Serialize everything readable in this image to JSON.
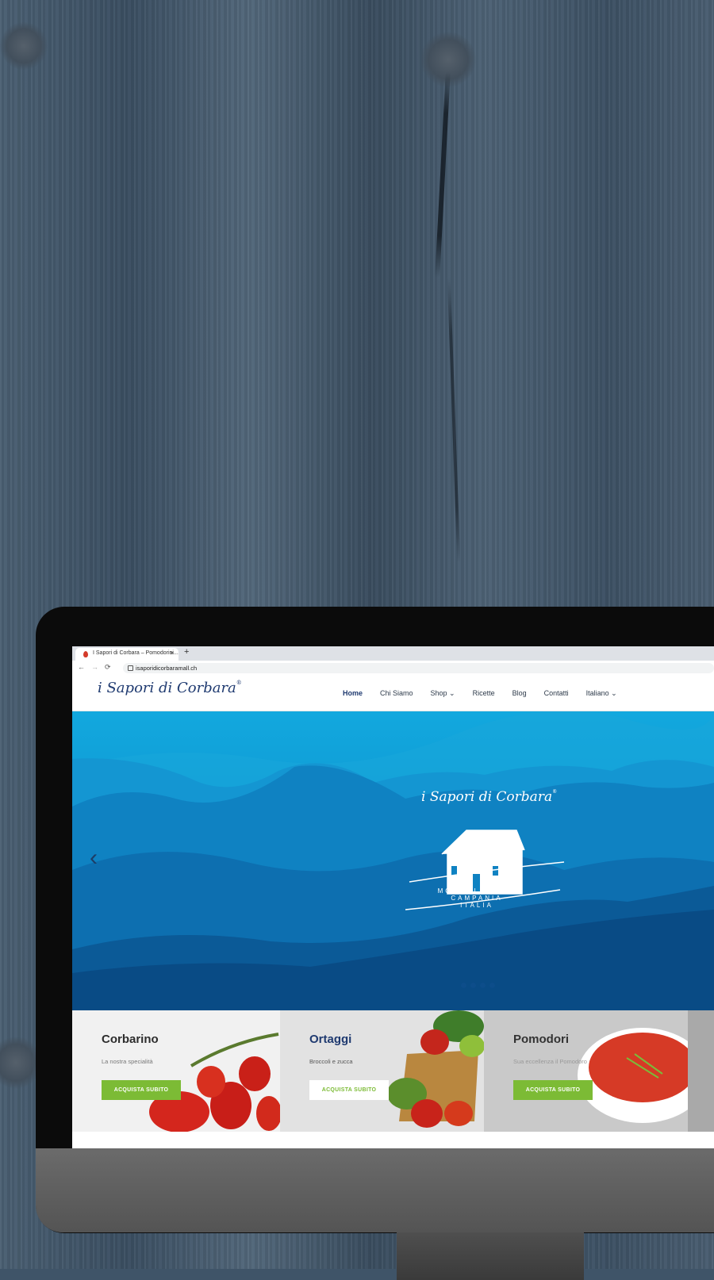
{
  "browser": {
    "tab_title": "I Sapori di Corbara – Pomodorini...",
    "tab_close": "×",
    "new_tab": "+",
    "url": "isaporidicorbaramall.ch",
    "back": "←",
    "forward": "→",
    "reload": "⟳"
  },
  "site": {
    "logo_text": "i Sapori di Corbara",
    "logo_reg": "®",
    "menu": [
      {
        "label": "Home"
      },
      {
        "label": "Chi Siamo"
      },
      {
        "label": "Shop ⌄"
      },
      {
        "label": "Ricette"
      },
      {
        "label": "Blog"
      },
      {
        "label": "Contatti"
      },
      {
        "label": "Italiano ⌄"
      }
    ]
  },
  "hero": {
    "logo_text": "i Sapori di Corbara",
    "logo_reg": "®",
    "tagline_line1": "MONTI LATTARI",
    "tagline_line2": "CAMPANIA",
    "tagline_line3": "ITALIA",
    "prev_arrow": "‹",
    "slides_count": 4
  },
  "products": [
    {
      "title": "Corbarino",
      "subtitle": "La nostra specialità",
      "button": "ACQUISTA SUBITO"
    },
    {
      "title": "Ortaggi",
      "subtitle": "Broccoli e zucca",
      "button": "ACQUISTA SUBITO"
    },
    {
      "title": "Pomodori",
      "subtitle": "Sua eccellenza il Pomodoro",
      "button": "ACQUISTA SUBITO"
    }
  ],
  "colors": {
    "accent_green": "#7cbb35",
    "brand_navy": "#1f3a70",
    "hero_blue": "#12a8de"
  }
}
